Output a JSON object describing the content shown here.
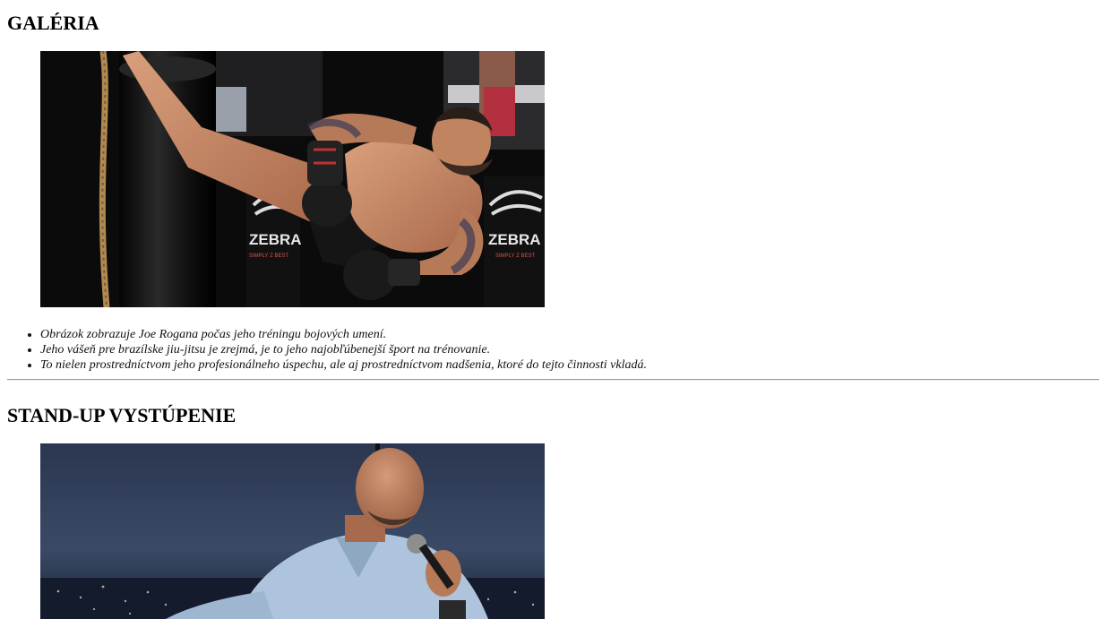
{
  "gallery": {
    "heading": "GALÉRIA",
    "photo_subject": "training-photo",
    "sign_left": "ZEBRA",
    "sign_left_sub": "SIMPLY Z BEST",
    "sign_right": "ZEBRA",
    "sign_right_sub": "SIMPLY Z BEST",
    "notes": [
      "Obrázok zobrazuje Joe Rogana počas jeho tréningu bojových umení.",
      "Jeho vášeň pre brazílske jiu-jitsu je zrejmá, je to jeho najobľúbenejší šport na trénovanie.",
      "To nielen prostredníctvom jeho profesionálneho úspechu, ale aj prostredníctvom nadšenia, ktoré do tejto činnosti vkladá."
    ]
  },
  "standup": {
    "heading": "STAND-UP VYSTÚPENIE",
    "photo_subject": "standup-photo"
  }
}
